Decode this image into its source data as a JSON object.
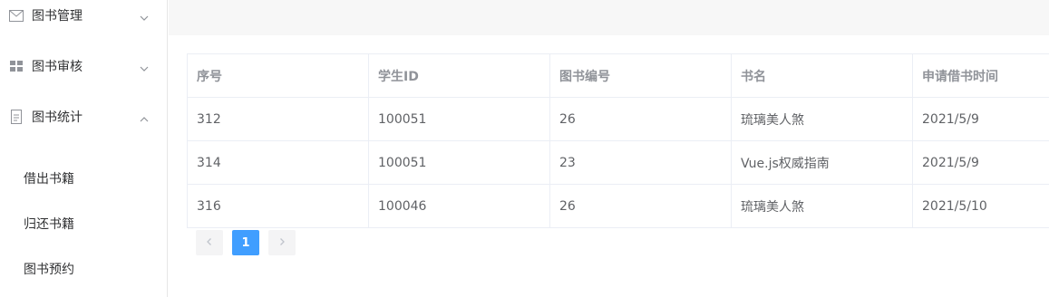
{
  "sidebar": {
    "menus": [
      {
        "label": "图书管理",
        "icon": "mail-icon",
        "expanded": false
      },
      {
        "label": "图书审核",
        "icon": "grid-icon",
        "expanded": false
      },
      {
        "label": "图书统计",
        "icon": "document-icon",
        "expanded": true
      }
    ],
    "sub_items": [
      "借出书籍",
      "归还书籍",
      "图书预约"
    ]
  },
  "table": {
    "columns": [
      "序号",
      "学生ID",
      "图书编号",
      "书名",
      "申请借书时间"
    ],
    "rows": [
      [
        "312",
        "100051",
        "26",
        "琉璃美人煞",
        "2021/5/9"
      ],
      [
        "314",
        "100051",
        "23",
        "Vue.js权威指南",
        "2021/5/9"
      ],
      [
        "316",
        "100046",
        "26",
        "琉璃美人煞",
        "2021/5/10"
      ]
    ]
  },
  "pagination": {
    "current_page": "1",
    "prev_icon": "chevron-left-icon",
    "next_icon": "chevron-right-icon"
  },
  "colors": {
    "accent": "#409eff",
    "text": "#303133",
    "cell_text": "#606266",
    "header_text": "#909399",
    "border": "#ebeef5"
  }
}
